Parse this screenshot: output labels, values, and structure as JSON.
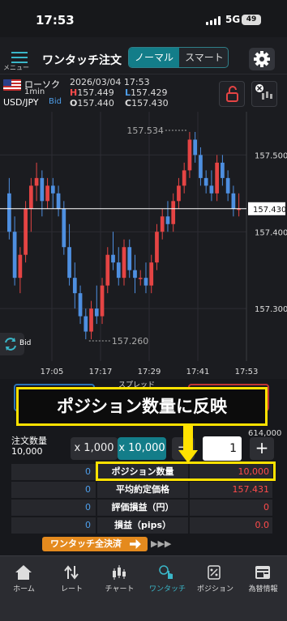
{
  "status_bar": {
    "time": "17:53",
    "network": "5G",
    "battery": "49"
  },
  "header": {
    "menu_label": "メニュー",
    "title": "ワンタッチ注文",
    "segment": [
      "ノーマル",
      "スマート"
    ]
  },
  "symbol": {
    "name": "ローソク",
    "timeframe": "1min",
    "pair": "USD/JPY",
    "side": "Bid",
    "datetime": "2026/03/04 17:53",
    "high_label": "H",
    "high": "157.449",
    "low_label": "L",
    "low": "157.429",
    "open_label": "O",
    "open": "157.440",
    "close_label": "C",
    "close": "157.430"
  },
  "chart_data": {
    "type": "candlestick",
    "price_labels": [
      "157.500",
      "157.400",
      "157.300"
    ],
    "current_price": "157.430",
    "high_marker": "157.534",
    "low_marker": "157.260",
    "time_labels": [
      "17:05",
      "17:17",
      "17:29",
      "17:41",
      "17:53"
    ],
    "ylim": [
      157.24,
      157.55
    ],
    "toggle_label": "Bid",
    "colors": {
      "up": "#e54444",
      "down": "#4e8fe0",
      "price_line": "#ffffff"
    },
    "candles": [
      [
        157.45,
        157.47,
        157.39,
        157.4
      ],
      [
        157.4,
        157.42,
        157.33,
        157.34
      ],
      [
        157.34,
        157.38,
        157.32,
        157.37
      ],
      [
        157.37,
        157.44,
        157.36,
        157.43
      ],
      [
        157.43,
        157.47,
        157.4,
        157.46
      ],
      [
        157.46,
        157.49,
        157.44,
        157.47
      ],
      [
        157.47,
        157.48,
        157.42,
        157.44
      ],
      [
        157.44,
        157.47,
        157.43,
        157.46
      ],
      [
        157.46,
        157.47,
        157.43,
        157.45
      ],
      [
        157.45,
        157.46,
        157.42,
        157.43
      ],
      [
        157.43,
        157.44,
        157.37,
        157.38
      ],
      [
        157.38,
        157.41,
        157.33,
        157.34
      ],
      [
        157.34,
        157.36,
        157.3,
        157.32
      ],
      [
        157.32,
        157.33,
        157.28,
        157.29
      ],
      [
        157.29,
        157.3,
        157.26,
        157.27
      ],
      [
        157.27,
        157.31,
        157.26,
        157.3
      ],
      [
        157.3,
        157.33,
        157.28,
        157.29
      ],
      [
        157.29,
        157.34,
        157.28,
        157.33
      ],
      [
        157.33,
        157.38,
        157.32,
        157.37
      ],
      [
        157.37,
        157.4,
        157.35,
        157.36
      ],
      [
        157.36,
        157.38,
        157.33,
        157.34
      ],
      [
        157.34,
        157.39,
        157.33,
        157.38
      ],
      [
        157.38,
        157.39,
        157.34,
        157.35
      ],
      [
        157.35,
        157.37,
        157.32,
        157.34
      ],
      [
        157.34,
        157.35,
        157.33,
        157.34
      ],
      [
        157.34,
        157.36,
        157.32,
        157.33
      ],
      [
        157.33,
        157.37,
        157.32,
        157.36
      ],
      [
        157.36,
        157.41,
        157.35,
        157.4
      ],
      [
        157.4,
        157.43,
        157.39,
        157.42
      ],
      [
        157.42,
        157.44,
        157.4,
        157.41
      ],
      [
        157.41,
        157.45,
        157.4,
        157.44
      ],
      [
        157.44,
        157.47,
        157.43,
        157.46
      ],
      [
        157.46,
        157.49,
        157.45,
        157.48
      ],
      [
        157.48,
        157.53,
        157.47,
        157.52
      ],
      [
        157.52,
        157.53,
        157.49,
        157.5
      ],
      [
        157.5,
        157.51,
        157.46,
        157.47
      ],
      [
        157.47,
        157.48,
        157.45,
        157.46
      ],
      [
        157.46,
        157.48,
        157.44,
        157.45
      ],
      [
        157.45,
        157.5,
        157.44,
        157.49
      ],
      [
        157.49,
        157.5,
        157.46,
        157.47
      ],
      [
        157.47,
        157.48,
        157.44,
        157.45
      ],
      [
        157.45,
        157.46,
        157.42,
        157.43
      ],
      [
        157.43,
        157.45,
        157.42,
        157.43
      ]
    ]
  },
  "panel": {
    "spread_label": "スプレッド",
    "order_qty_label": "注文数量",
    "order_qty_value": "10,000",
    "qty_buttons": [
      "x 1,000",
      "x 10,000"
    ],
    "minus": "−",
    "plus": "+",
    "qty_input": "1",
    "available": "614,000",
    "stats": [
      {
        "left": "0",
        "label": "ポジション数量",
        "right": "10,000"
      },
      {
        "left": "0",
        "label": "平均約定価格",
        "right": "157.431"
      },
      {
        "left": "0",
        "label": "評価損益（円）",
        "right": "0"
      },
      {
        "left": "0",
        "label": "損益（pips）",
        "right": "0.0"
      }
    ],
    "close_all": "ワンタッチ全決済",
    "arrows": "▶▶▶"
  },
  "tabs": [
    {
      "label": "ホーム",
      "icon": "home-icon"
    },
    {
      "label": "レート",
      "icon": "rate-icon"
    },
    {
      "label": "チャート",
      "icon": "chart-icon"
    },
    {
      "label": "ワンタッチ",
      "icon": "one-touch-icon"
    },
    {
      "label": "ポジション",
      "icon": "position-icon"
    },
    {
      "label": "為替情報",
      "icon": "news-icon"
    }
  ],
  "annotation": {
    "banner": "ポジション数量に反映",
    "color": "#ffe200"
  }
}
